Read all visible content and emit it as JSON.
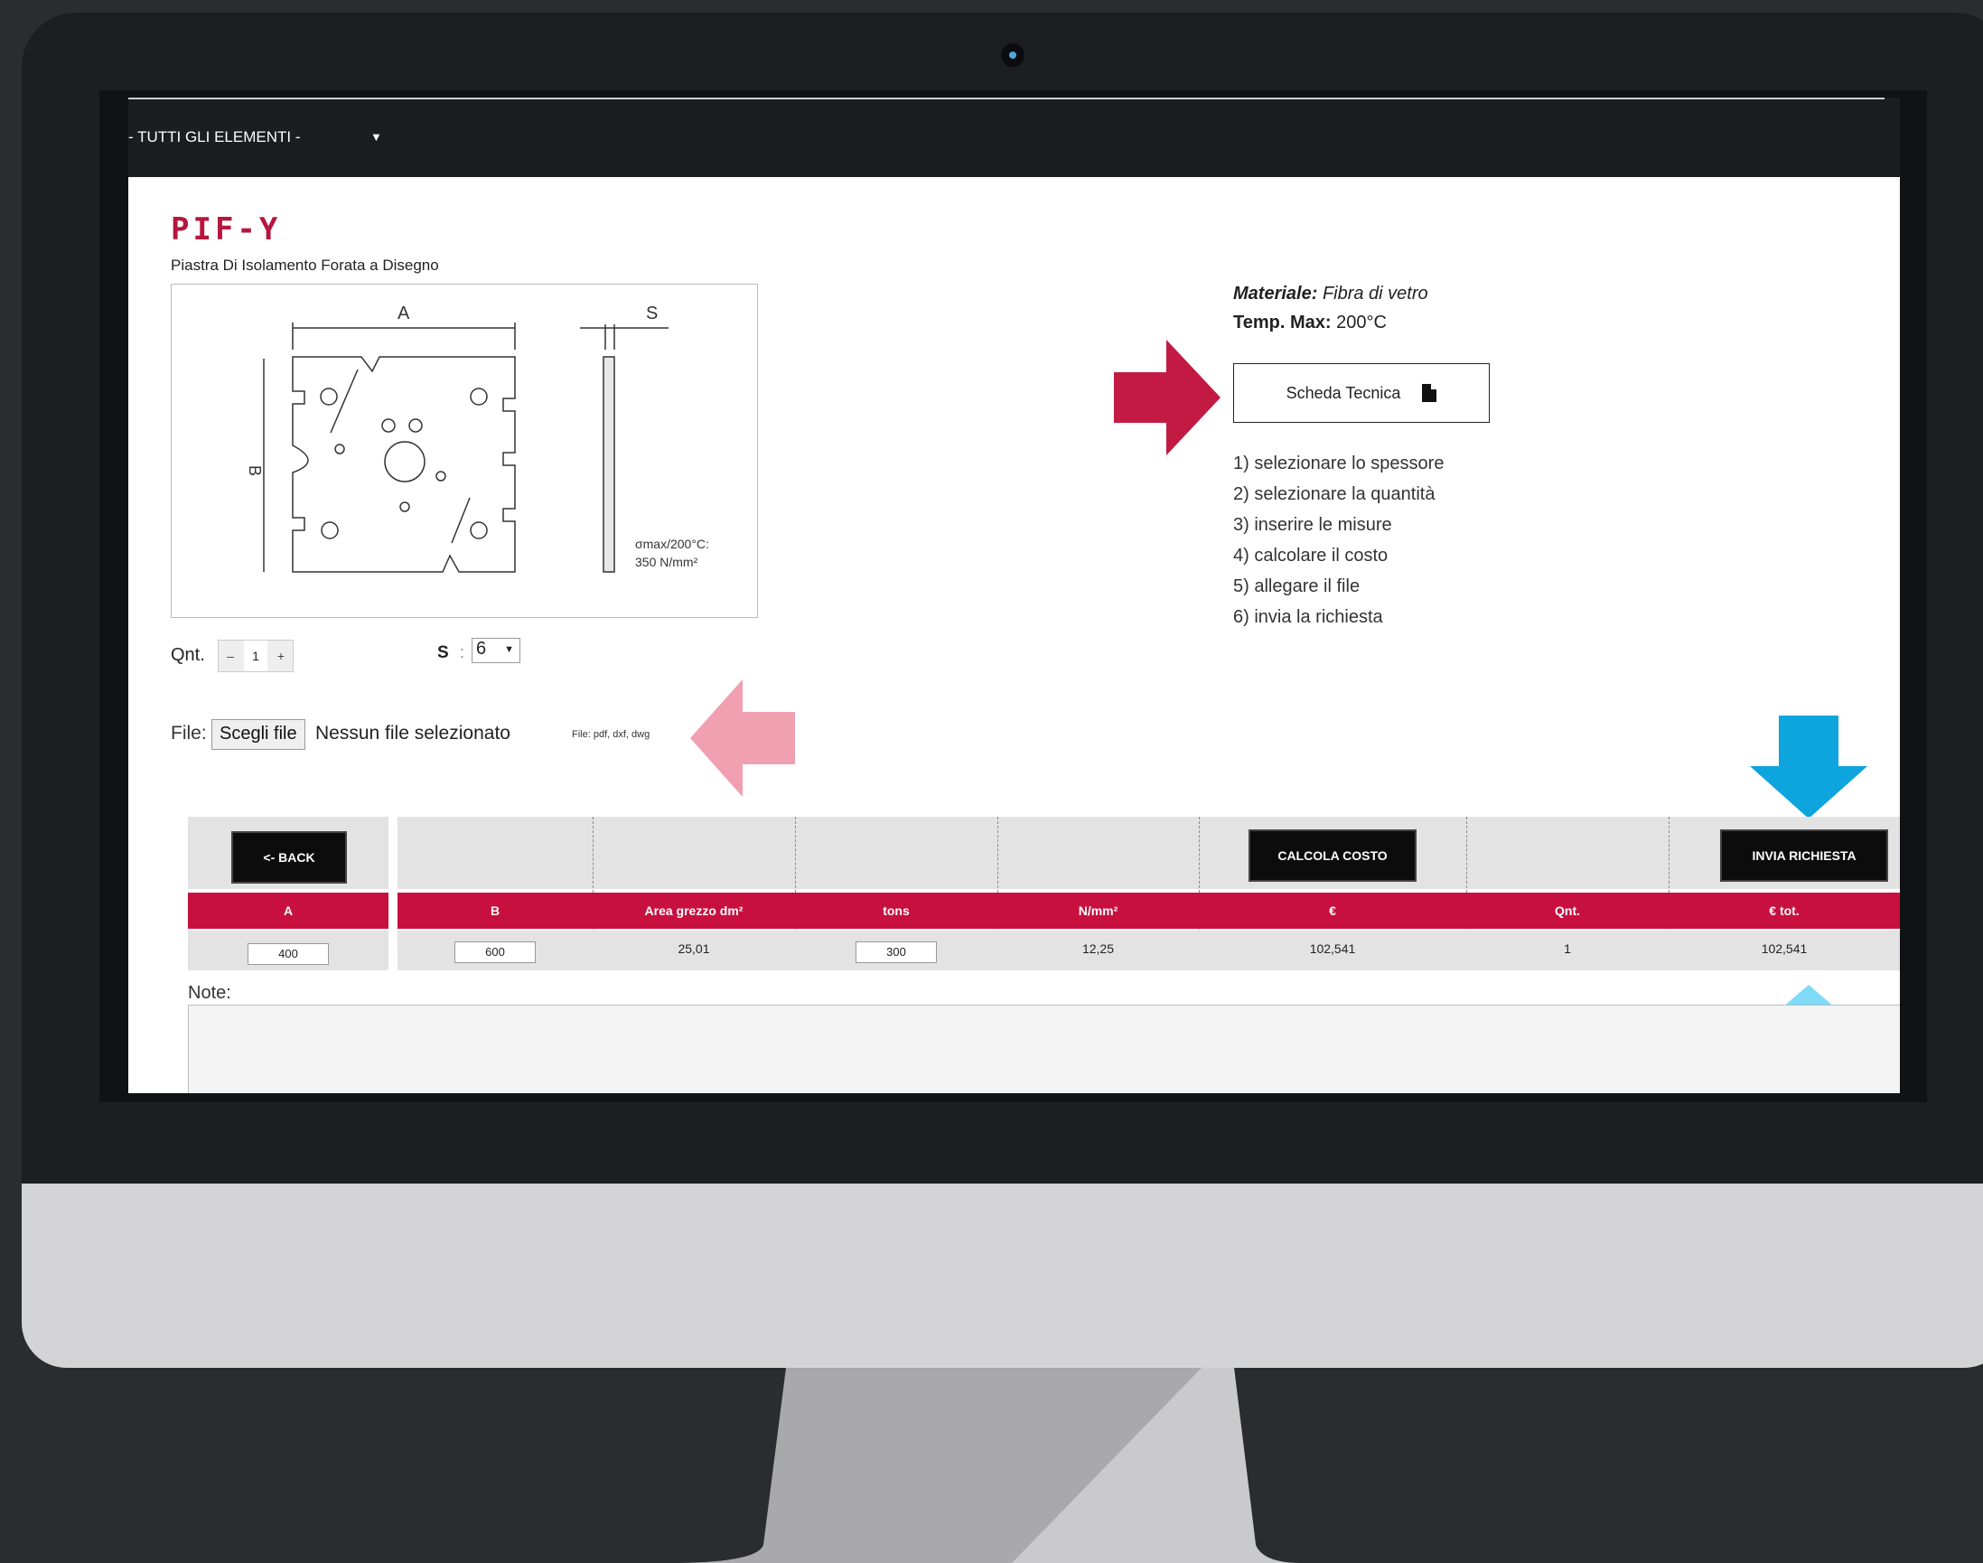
{
  "colors": {
    "accent": "#c8103f",
    "pink_arrow": "#f0a0b0",
    "blue_arrow": "#0ea4dd",
    "light_blue_arrow": "#80dbf8"
  },
  "topbar": {
    "category_select": "- TUTTI GLI ELEMENTI -"
  },
  "product": {
    "code": "PIF-Y",
    "subtitle": "Piastra Di Isolamento Forata a Disegno",
    "drawing": {
      "label_a": "A",
      "label_b": "B",
      "label_s": "S",
      "sigma_line1": "σmax/200°C:",
      "sigma_line2": "350 N/mm²"
    }
  },
  "info": {
    "material_label": "Materiale:",
    "material_value": "Fibra di vetro",
    "temp_label": "Temp. Max:",
    "temp_value": "200°C",
    "datasheet_button": "Scheda Tecnica",
    "steps": [
      "1) selezionare lo spessore",
      "2) selezionare la quantità",
      "3) inserire le misure",
      "4) calcolare il costo",
      "5) allegare il file",
      "6) invia la richiesta"
    ]
  },
  "controls": {
    "qnt_label": "Qnt.",
    "qnt_minus": "–",
    "qnt_value": "1",
    "qnt_plus": "+",
    "s_label": "S",
    "s_colon": ":",
    "s_value": "6",
    "file_label": "File:",
    "file_button": "Scegli file",
    "file_status": "Nessun file selezionato",
    "file_hint": "File: pdf, dxf, dwg"
  },
  "table": {
    "back_button": "<- BACK",
    "calc_button": "CALCOLA COSTO",
    "send_button": "INVIA RICHIESTA",
    "headers": [
      "A",
      "B",
      "Area grezzo dm²",
      "tons",
      "N/mm²",
      "€",
      "Qnt.",
      "€ tot."
    ],
    "row": {
      "a": "400",
      "b": "600",
      "area": "25,01",
      "tons": "300",
      "nmm": "12,25",
      "eur": "102,541",
      "qnt": "1",
      "eur_tot": "102,541"
    }
  },
  "note": {
    "label": "Note:"
  }
}
